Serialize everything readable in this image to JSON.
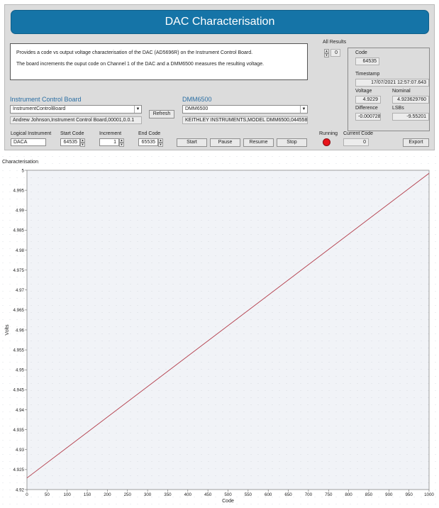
{
  "header": {
    "title": "DAC Characterisation"
  },
  "description": {
    "line1": "Provides a code vs output voltage characterisation of the DAC (AD5696R) on the Instrument Control Board.",
    "line2": "The board increments the ouput code on Channel 1 of the DAC and a DMM6500 measures the resulting voltage."
  },
  "instrument_board": {
    "section_title": "Instrument Control Board",
    "selected": "InstrumentControlBoard",
    "id_string": "Andrew Johnson,Instrument Control Board,00001,0.0.1",
    "refresh_label": "Refresh"
  },
  "dmm": {
    "section_title": "DMM6500",
    "selected": "DMM6500",
    "id_string": "KEITHLEY INSTRUMENTS,MODEL DMM6500,04455804,1.7.7b"
  },
  "controls": {
    "logical_instrument_label": "Logical Instrument",
    "logical_instrument_value": "DACA",
    "start_code_label": "Start Code",
    "start_code_value": "64535",
    "increment_label": "Increment",
    "increment_value": "1",
    "end_code_label": "End Code",
    "end_code_value": "65535",
    "start_label": "Start",
    "pause_label": "Pause",
    "resume_label": "Resume",
    "stop_label": "Stop",
    "running_label": "Running",
    "current_code_label": "Current Code",
    "current_code_value": "0",
    "export_label": "Export"
  },
  "results": {
    "all_results_label": "All Results",
    "index_value": "0",
    "code_label": "Code",
    "code_value": "64535",
    "timestamp_label": "Timestamp",
    "timestamp_value": "17/07/2021 12:57:07.643",
    "voltage_label": "Voltage",
    "voltage_value": "4.9229",
    "nominal_label": "Nominal",
    "nominal_value": "4.923629760",
    "difference_label": "Difference",
    "difference_value": "-0.00072876",
    "lsbs_label": "LSBs",
    "lsbs_value": "-9.55201"
  },
  "chart_data": {
    "type": "line",
    "title": "Characterisation",
    "xlabel": "Code",
    "ylabel": "Volts",
    "xlim": [
      0,
      1000
    ],
    "ylim": [
      4.92,
      5.0
    ],
    "x_ticks": [
      "0",
      "50",
      "100",
      "150",
      "200",
      "250",
      "300",
      "350",
      "400",
      "450",
      "500",
      "550",
      "600",
      "650",
      "700",
      "750",
      "800",
      "850",
      "900",
      "950",
      "1000"
    ],
    "y_ticks": [
      "4.92",
      "4.925",
      "4.93",
      "4.935",
      "4.94",
      "4.945",
      "4.95",
      "4.955",
      "4.96",
      "4.965",
      "4.97",
      "4.975",
      "4.98",
      "4.985",
      "4.99",
      "4.995",
      "5"
    ],
    "grid": true,
    "series": [
      {
        "x": [
          0,
          1000
        ],
        "y": [
          4.9229,
          4.99925
        ],
        "color": "#b23a48"
      }
    ],
    "background": "#f1f3f7"
  }
}
